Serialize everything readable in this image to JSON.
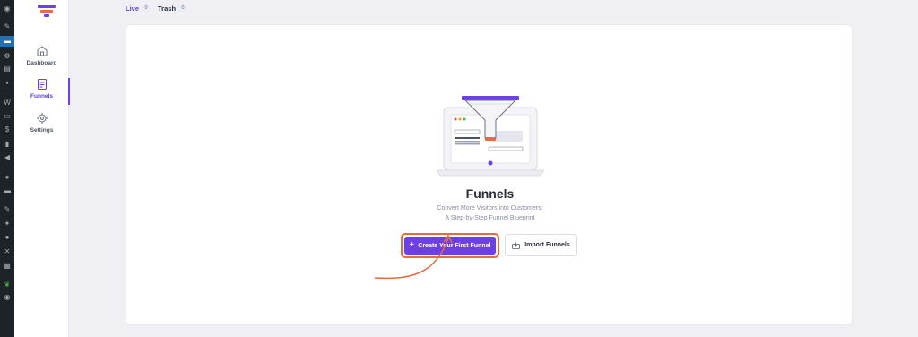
{
  "wp_admin_bar": {
    "icons": [
      "dashboard-icon",
      "pin-icon",
      "funnel-plugin-icon",
      "media-icon",
      "pages-icon",
      "comments-icon",
      "woo-icon",
      "products-icon",
      "payments-icon",
      "analytics-icon",
      "marketing-icon",
      "plugin-icon",
      "folder-icon",
      "appearance-icon",
      "plugins-icon",
      "users-icon",
      "tools-icon",
      "settings-icon",
      "leaf-icon",
      "collapse-icon"
    ]
  },
  "sidebar": {
    "items": [
      {
        "label": "Dashboard",
        "icon": "home-icon"
      },
      {
        "label": "Funnels",
        "icon": "funnels-doc-icon"
      },
      {
        "label": "Settings",
        "icon": "gear-icon"
      }
    ]
  },
  "tabs": [
    {
      "label": "Live",
      "count": "0"
    },
    {
      "label": "Trash",
      "count": "0"
    }
  ],
  "empty_state": {
    "title": "Funnels",
    "subtitle_line1": "Convert More Visitors into Customers:",
    "subtitle_line2": "A Step-by-Step Funnel Blueprint",
    "primary_button": "Create Your First Funnel",
    "secondary_button": "Import Funnels"
  },
  "colors": {
    "accent": "#6c3fe8",
    "highlight": "#e86a42",
    "admin_bar": "#1d2327"
  }
}
